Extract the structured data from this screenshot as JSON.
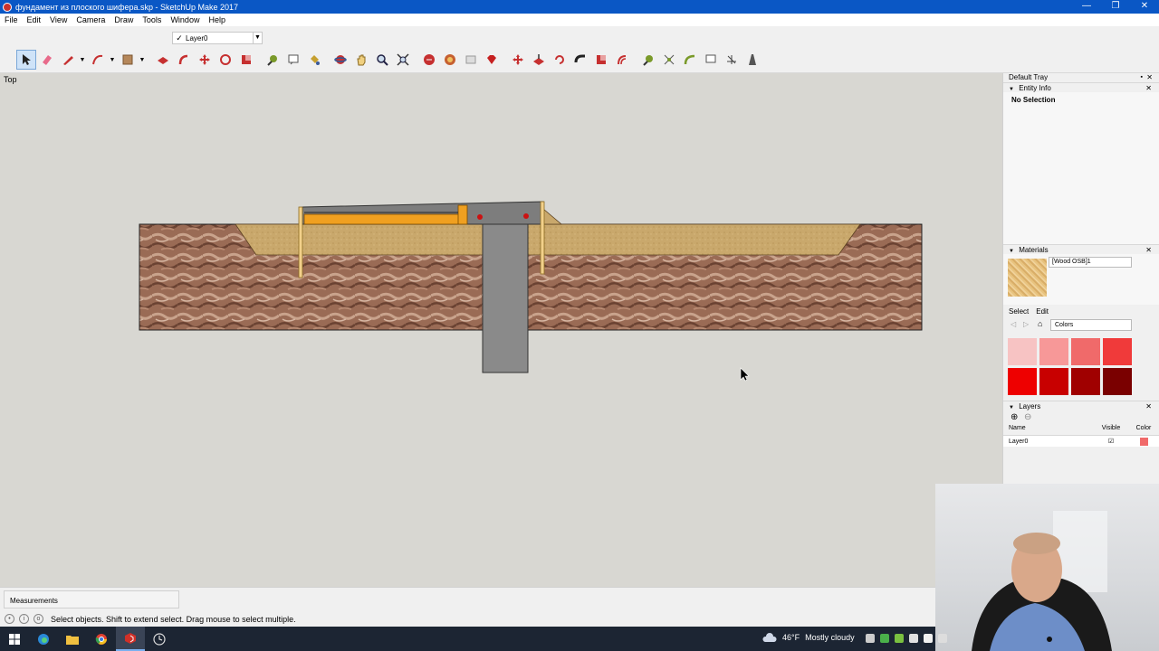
{
  "window": {
    "title": "фундамент из плоского шифера.skp - SketchUp Make 2017",
    "minimize": "—",
    "restore": "❐",
    "close": "✕"
  },
  "menu": [
    "File",
    "Edit",
    "View",
    "Camera",
    "Draw",
    "Tools",
    "Window",
    "Help"
  ],
  "layer_toolbar": {
    "current_layer": "Layer0"
  },
  "viewport": {
    "view_label": "Top"
  },
  "measurements": {
    "label": "Measurements"
  },
  "status": {
    "hint": "Select objects. Shift to extend select. Drag mouse to select multiple."
  },
  "tray": {
    "title": "Default Tray",
    "entity_info": {
      "header": "Entity Info",
      "selection": "No Selection"
    },
    "materials": {
      "header": "Materials",
      "current": "[Wood OSB]1",
      "tab_select": "Select",
      "tab_edit": "Edit",
      "library": "Colors",
      "swatches": [
        "#f7c3c3",
        "#f79898",
        "#f06a6a",
        "#f03a3a",
        "#ee0000",
        "#c80000",
        "#a00000",
        "#7a0000"
      ]
    },
    "layers": {
      "header": "Layers",
      "col_name": "Name",
      "col_visible": "Visible",
      "col_color": "Color",
      "rows": [
        {
          "name": "Layer0",
          "visible": "☑",
          "color": "#f06a6a"
        }
      ]
    }
  },
  "taskbar": {
    "weather_temp": "46°F",
    "weather_text": "Mostly cloudy"
  },
  "colors": {
    "titlebar": "#0a57c5",
    "viewport_bg": "#d8d7d2",
    "concrete": "#8a8a8a",
    "sand": "#c9a86c",
    "osb": "#f0a020",
    "accent_red": "#cc1111"
  }
}
